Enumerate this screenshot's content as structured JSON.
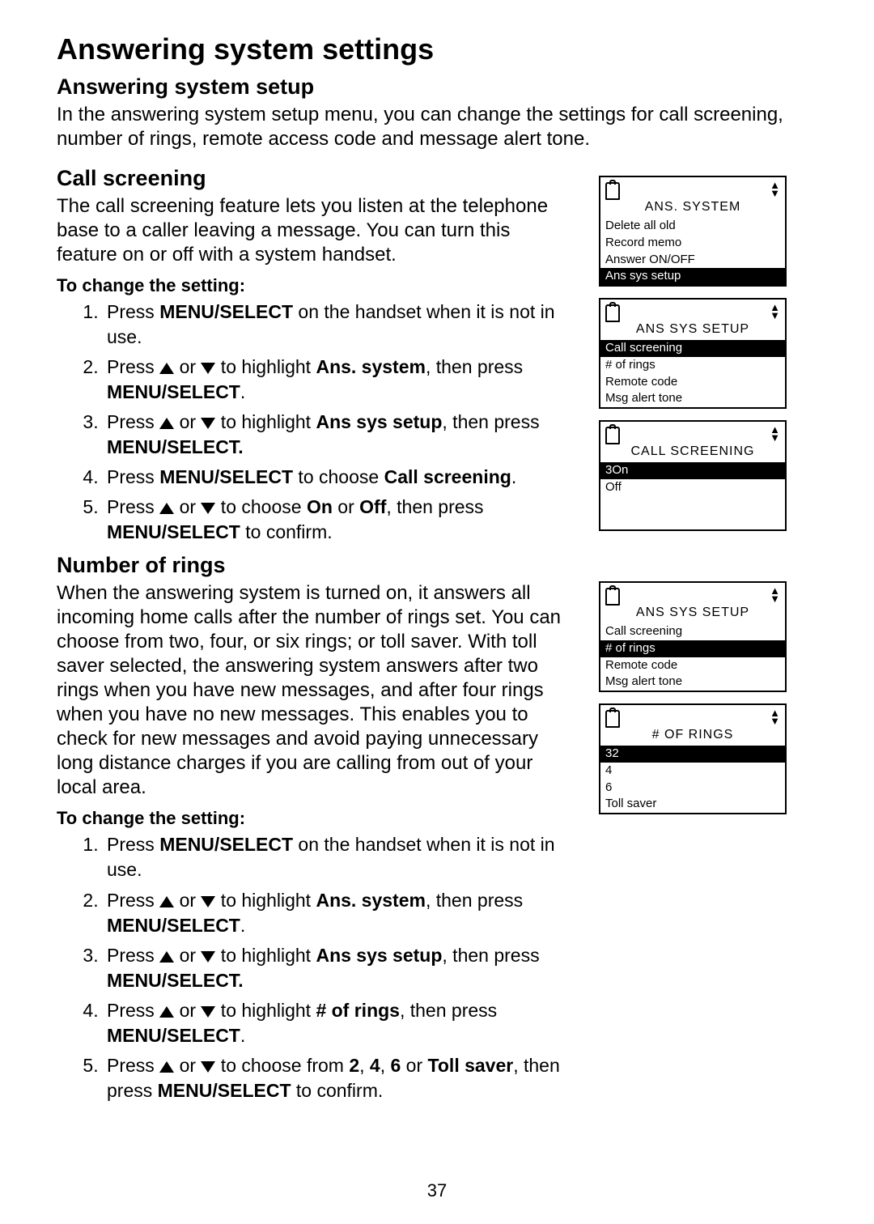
{
  "title": "Answering system settings",
  "sec1": {
    "heading": "Answering system setup",
    "body": "In the answering system setup menu, you can change the settings for call screening, number of rings, remote access code and message alert tone."
  },
  "sec2": {
    "heading": "Call screening",
    "body": "The call screening feature lets you listen at the telephone base to a caller leaving a message. You can turn this feature on or off with a system handset.",
    "changeHead": "To change the setting:",
    "s1a": "Press ",
    "s1b": "MENU/",
    "s1c": "SELECT",
    "s1d": " on the handset when it is not in use.",
    "s2a": "Press ",
    "s2b": " or ",
    "s2c": " to highlight ",
    "s2d": "Ans. system",
    "s2e": ", then press ",
    "s2f": "MENU",
    "s2g": "/SELECT",
    "s2h": ".",
    "s3a": "Press ",
    "s3b": " or ",
    "s3c": " to highlight ",
    "s3d": "Ans sys setup",
    "s3e": ", then press ",
    "s3f": "MENU",
    "s3g": "/SELECT.",
    "s4a": "Press ",
    "s4b": "MENU",
    "s4c": "/SELECT",
    "s4d": " to choose ",
    "s4e": "Call screening",
    "s4f": ".",
    "s5a": "Press ",
    "s5b": " or ",
    "s5c": " to choose ",
    "s5d": "On",
    "s5e": " or ",
    "s5f": "Off",
    "s5g": ", then press ",
    "s5h": "MENU",
    "s5i": "/SELECT",
    "s5j": " to confirm."
  },
  "sec3": {
    "heading": "Number of rings",
    "body": "When the answering system is turned on, it answers all incoming home calls after the number of rings set. You can choose from two, four, or six rings; or toll saver. With toll saver selected, the answering system answers after two rings when you have new messages, and after four rings when you have no new messages. This enables you to check for new messages and avoid paying unnecessary long distance charges if you are calling from out of your local area.",
    "changeHead": "To change the setting:",
    "s1a": "Press ",
    "s1b": "MENU/",
    "s1c": "SELECT",
    "s1d": " on the handset when it is not in use.",
    "s2a": "Press ",
    "s2b": " or ",
    "s2c": " to highlight ",
    "s2d": "Ans. system",
    "s2e": ", then press ",
    "s2f": "MENU",
    "s2g": "/SELECT",
    "s2h": ".",
    "s3a": "Press ",
    "s3b": " or ",
    "s3c": " to highlight ",
    "s3d": "Ans sys setup",
    "s3e": ", then press ",
    "s3f": "MENU",
    "s3g": "/SELECT.",
    "s4a": "Press  ",
    "s4b": " or ",
    "s4c": " to highlight ",
    "s4d": "# of rings",
    "s4e": ", then press ",
    "s4f": "MENU",
    "s4g": "/SELECT",
    "s4h": ".",
    "s5a": "Press ",
    "s5b": " or ",
    "s5c": " to choose from ",
    "s5d": "2",
    "s5e": ", ",
    "s5f": "4",
    "s5g": ", ",
    "s5h": "6",
    "s5i": " or ",
    "s5j": "Toll saver",
    "s5k": ", then press ",
    "s5l": "MENU",
    "s5m": "/SELECT",
    "s5n": " to confirm."
  },
  "lcd1": {
    "title": "ANS. SYSTEM",
    "r1": "Delete all old",
    "r2": "Record memo",
    "r3": "Answer ON/OFF",
    "r4": "Ans sys setup"
  },
  "lcd2": {
    "title": "ANS SYS SETUP",
    "r1": "Call screening",
    "r2": "# of rings",
    "r3": "Remote code",
    "r4": "Msg alert tone"
  },
  "lcd3": {
    "title": "CALL SCREENING",
    "r1": "3On",
    "r2": "Off"
  },
  "lcd4": {
    "title": "ANS SYS SETUP",
    "r1": "Call screening",
    "r2": "# of rings",
    "r3": "Remote code",
    "r4": "Msg alert tone"
  },
  "lcd5": {
    "title": "# OF RINGS",
    "r1": "32",
    "r2": "4",
    "r3": "6",
    "r4": "Toll saver"
  },
  "pageNum": "37"
}
